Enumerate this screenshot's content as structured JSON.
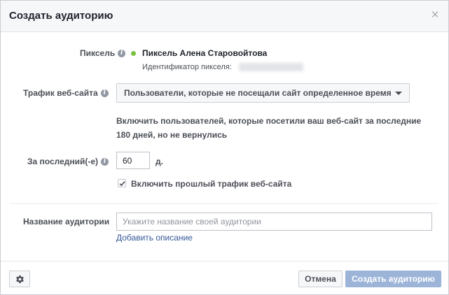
{
  "dialog": {
    "title": "Создать аудиторию",
    "close_glyph": "×"
  },
  "pixel": {
    "label": "Пиксель",
    "name": "Пиксель Алена Старовойтова",
    "id_label": "Идентификатор пикселя:",
    "status_color": "#7ac143"
  },
  "traffic": {
    "label": "Трафик веб-сайта",
    "selected": "Пользователи, которые не посещали сайт определенное время",
    "description": "Включить пользователей, которые посетили ваш веб-сайт за последние 180 дней, но не вернулись"
  },
  "period": {
    "label": "За последний(-е)",
    "value": "60",
    "unit": "д."
  },
  "past_traffic": {
    "label": "Включить прошлый трафик веб-сайта",
    "checked": true
  },
  "audience_name": {
    "label": "Название аудитории",
    "placeholder": "Укажите название своей аудитории",
    "add_description": "Добавить описание"
  },
  "footer": {
    "cancel_label": "Отмена",
    "create_label": "Создать аудиторию",
    "settings_icon": "gear-icon"
  },
  "info_glyph": "i"
}
